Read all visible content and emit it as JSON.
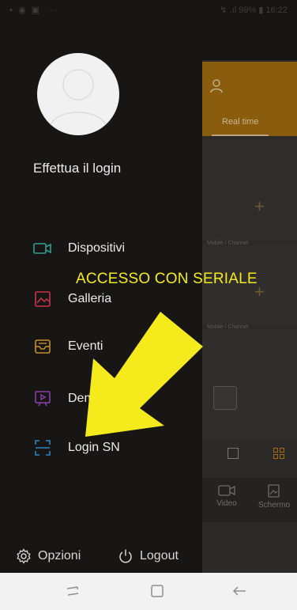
{
  "status_bar": {
    "left_icons": "▪ ◉ ▣ ···",
    "right_text": "↯ .ıl 99% ▮ 16:22"
  },
  "app_background": {
    "realtime_tab_label": "Real time",
    "cell_caption_1": "Mobile / Channel",
    "cell_caption_2": "Mobile / Channel",
    "add_symbol": "+",
    "bottom_tabs": [
      {
        "label": "Video",
        "icon": "video-icon"
      },
      {
        "label": "Schermo",
        "icon": "image-icon"
      }
    ]
  },
  "drawer": {
    "avatar_icon": "user-avatar-icon",
    "login_prompt": "Effettua il login",
    "menu_items": [
      {
        "label": "Dispositivi",
        "icon": "camera-icon",
        "color": "#2f9e8f"
      },
      {
        "label": "Galleria",
        "icon": "gallery-icon",
        "color": "#c8344b"
      },
      {
        "label": "Eventi",
        "icon": "inbox-icon",
        "color": "#c7902b"
      },
      {
        "label": "Demo",
        "icon": "play-screen-icon",
        "color": "#8c3fa8"
      },
      {
        "label": "Login SN",
        "icon": "scan-icon",
        "color": "#2b86c4"
      }
    ],
    "footer": {
      "options_label": "Opzioni",
      "logout_label": "Logout"
    }
  },
  "annotation": {
    "text": "ACCESSO CON SERIALE",
    "color": "#f4ea1c"
  },
  "colors": {
    "accent_orange": "#8a5c0e",
    "drawer_bg": "#171615"
  }
}
